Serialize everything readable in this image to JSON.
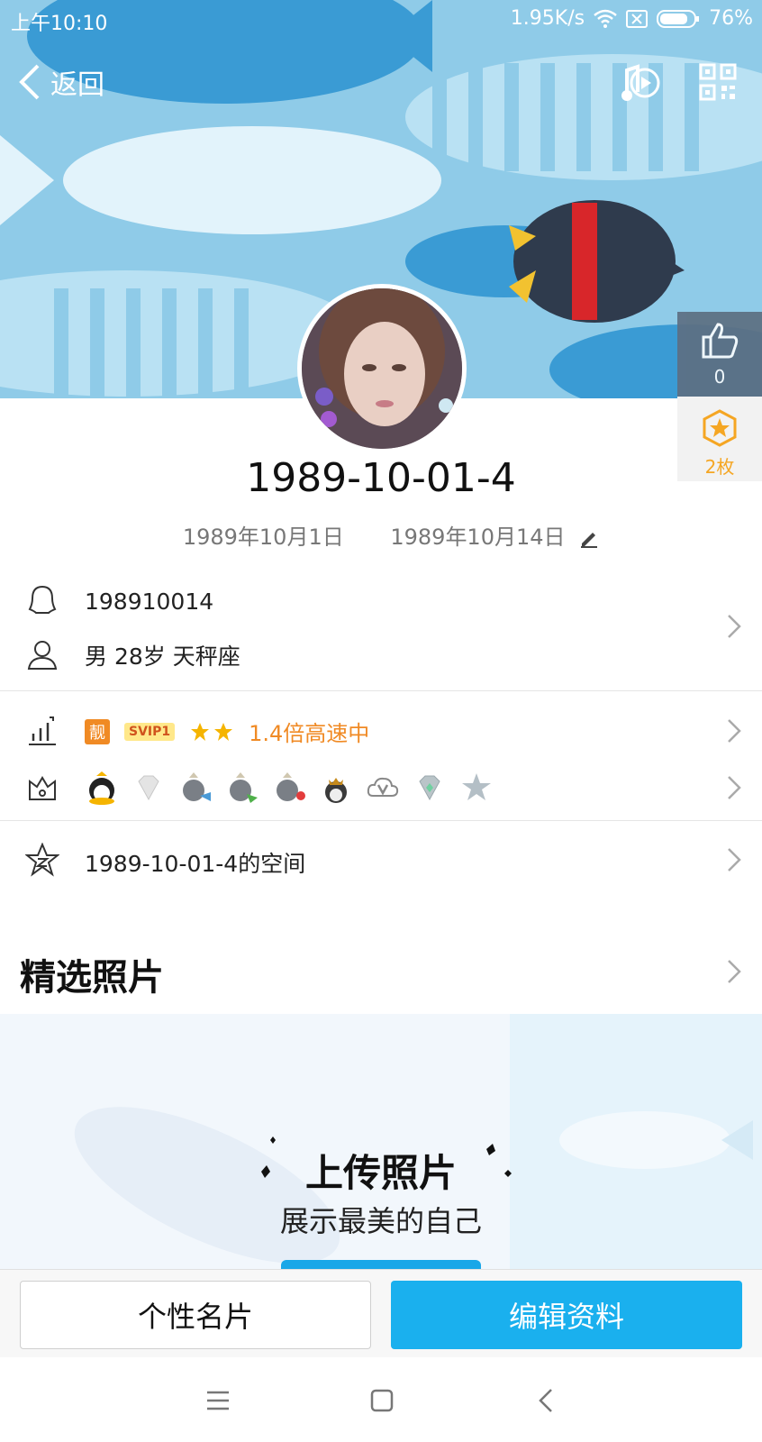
{
  "status_bar": {
    "time": "上午10:10",
    "net_speed": "1.95K/s",
    "battery": "76%"
  },
  "nav": {
    "back_label": "返回"
  },
  "side": {
    "like_count": "0",
    "medal_count": "2枚"
  },
  "profile": {
    "nickname": "1989-10-01-4",
    "birthday": "1989年10月1日",
    "date2": "1989年10月14日"
  },
  "info": {
    "qq_number": "198910014",
    "gender_age": "男  28岁  天秤座"
  },
  "vip": {
    "liang": "靓",
    "svip": "SVIP1",
    "speed": "1.4倍高速中"
  },
  "space": {
    "label": "1989-10-01-4的空间"
  },
  "photos": {
    "section_title": "精选照片",
    "upload_title": "上传照片",
    "upload_sub": "展示最美的自己"
  },
  "bottom": {
    "card_label": "个性名片",
    "edit_label": "编辑资料"
  },
  "colors": {
    "accent": "#1ab0ee",
    "orange": "#f08a24",
    "header_bg": "#8fcbe8"
  }
}
